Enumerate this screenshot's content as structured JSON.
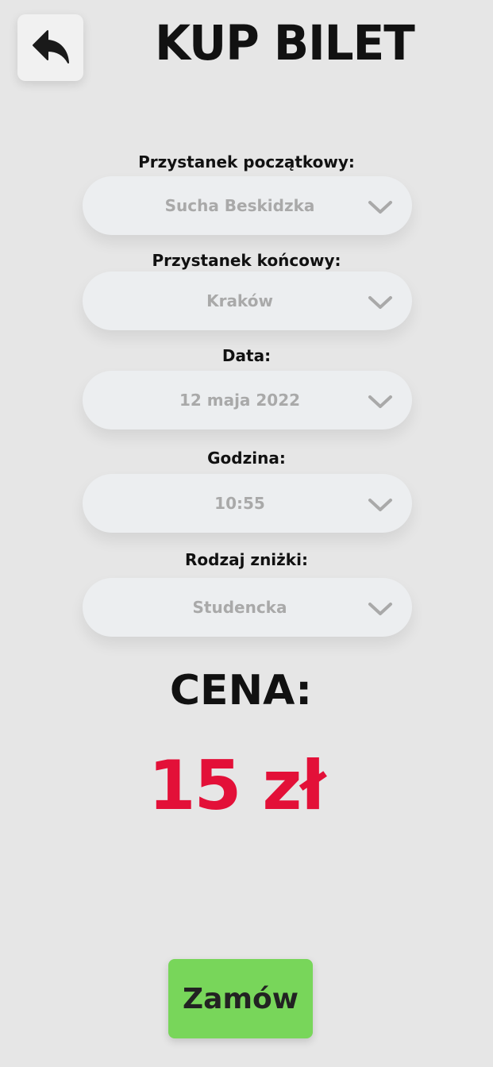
{
  "header": {
    "title": "KUP BILET",
    "back_icon": "back-arrow-icon"
  },
  "form": {
    "fields": [
      {
        "label": "Przystanek początkowy:",
        "value": "Sucha Beskidzka"
      },
      {
        "label": "Przystanek końcowy:",
        "value": "Kraków"
      },
      {
        "label": "Data:",
        "value": "12 maja 2022"
      },
      {
        "label": "Godzina:",
        "value": "10:55"
      },
      {
        "label": "Rodzaj zniżki:",
        "value": "Studencka"
      }
    ]
  },
  "price": {
    "label": "CENA:",
    "value": "15 zł"
  },
  "order_button": {
    "label": "Zamów"
  },
  "colors": {
    "background": "#e6e6e6",
    "price": "#e31038",
    "order_button": "#78d65a",
    "select_bg": "#eceef0",
    "select_text": "#a9a9a9",
    "chevron": "#a9a9a9"
  }
}
